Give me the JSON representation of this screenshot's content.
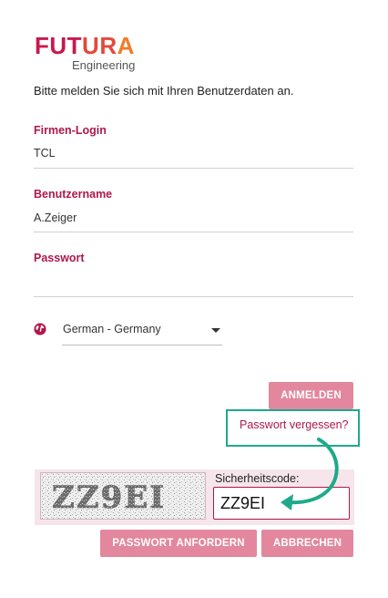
{
  "logo": {
    "brand_word": [
      "FUT",
      "UR",
      "A"
    ],
    "sub": "Engineering"
  },
  "intro": "Bitte melden Sie sich mit Ihren Benutzerdaten an.",
  "fields": {
    "company_login": {
      "label": "Firmen-Login",
      "value": "TCL"
    },
    "username": {
      "label": "Benutzername",
      "value": "A.Zeiger"
    },
    "password": {
      "label": "Passwort",
      "value": ""
    }
  },
  "language": {
    "icon": "globe-icon",
    "selected": "German - Germany"
  },
  "buttons": {
    "login": "Anmelden",
    "request_password": "Passwort anfordern",
    "cancel": "Abbrechen"
  },
  "forgot_password": "Passwort vergessen?",
  "captcha": {
    "image_text": "ZZ9EI",
    "label": "Sicherheitscode:",
    "input_value": "ZZ9EI"
  },
  "colors": {
    "brand": "#b0174a",
    "button": "#e2879e",
    "highlight": "#1fa98b"
  }
}
